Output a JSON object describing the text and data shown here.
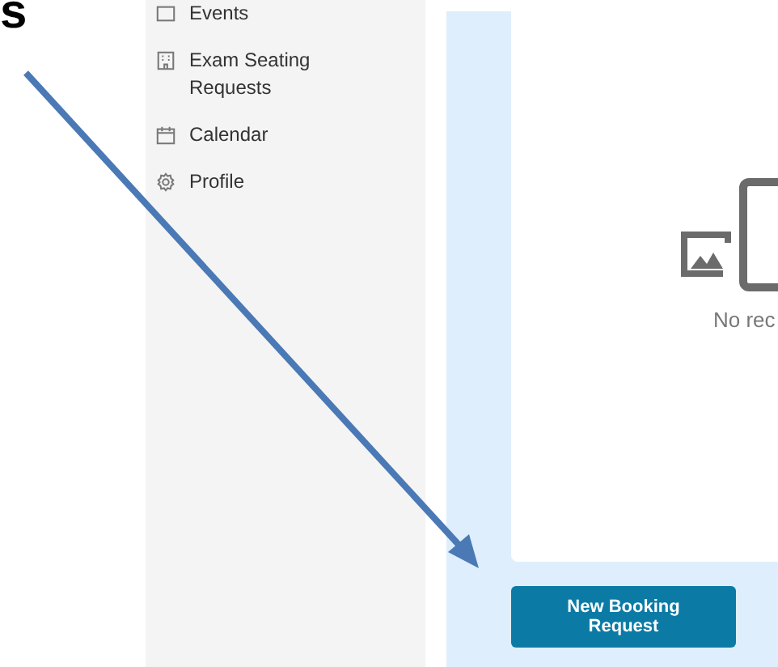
{
  "annotation": {
    "text": "s"
  },
  "sidebar": {
    "items": [
      {
        "label": "Events"
      },
      {
        "label": "Exam Seating Requests"
      },
      {
        "label": "Calendar"
      },
      {
        "label": "Profile"
      }
    ]
  },
  "empty_state": {
    "text": "No rec"
  },
  "buttons": [
    "New Booking Request"
  ]
}
